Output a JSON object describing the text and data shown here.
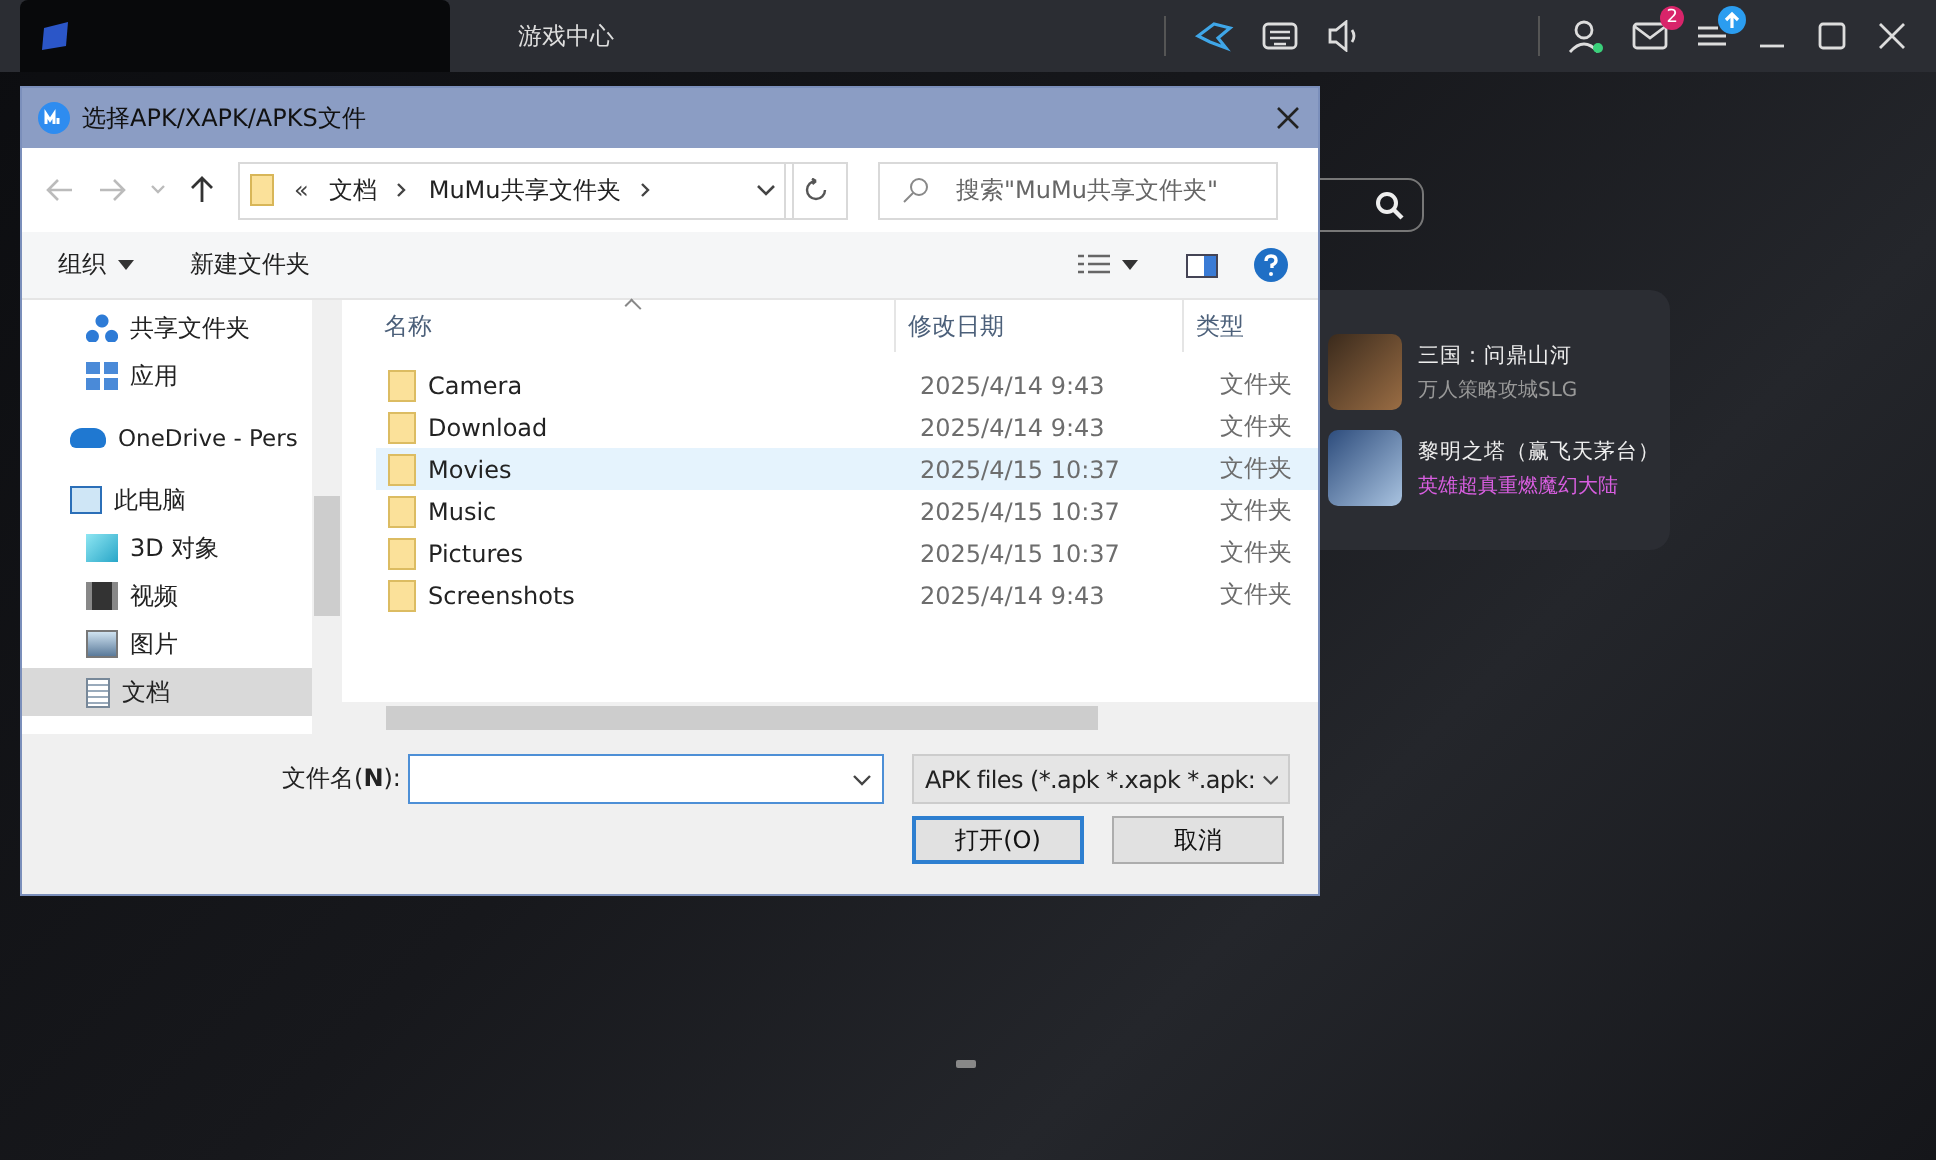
{
  "top_bar": {
    "tab": "游戏中心",
    "mail_badge": "2"
  },
  "game_list": [
    {
      "title": "三国：问鼎山河",
      "subtitle": "万人策略攻城SLG",
      "kind": "plain"
    },
    {
      "title": "黎明之塔（赢飞天茅台）",
      "subtitle": "英雄超真重燃魔幻大陆",
      "kind": "promo"
    }
  ],
  "dialog": {
    "title": "选择APK/XAPK/APKS文件",
    "address": {
      "prefix": "«",
      "segments": [
        "文档",
        "MuMu共享文件夹"
      ]
    },
    "search": {
      "placeholder": "搜索\"MuMu共享文件夹\""
    },
    "toolbar": {
      "organize": "组织",
      "new_folder": "新建文件夹"
    },
    "nav": [
      {
        "label": "共享文件夹",
        "kind": "share",
        "selected": false
      },
      {
        "label": "应用",
        "kind": "apps",
        "selected": false
      },
      {
        "label": "OneDrive - Pers",
        "kind": "cloud",
        "selected": false
      },
      {
        "label": "此电脑",
        "kind": "pc",
        "selected": false,
        "children": [
          {
            "label": "3D 对象",
            "kind": "cube",
            "selected": false
          },
          {
            "label": "视频",
            "kind": "video",
            "selected": false
          },
          {
            "label": "图片",
            "kind": "picture",
            "selected": false
          },
          {
            "label": "文档",
            "kind": "doc",
            "selected": true
          }
        ]
      }
    ],
    "columns": [
      "名称",
      "修改日期",
      "类型"
    ],
    "rows": [
      {
        "name": "Camera",
        "date": "2025/4/14 9:43",
        "type": "文件夹",
        "selected": false
      },
      {
        "name": "Download",
        "date": "2025/4/14 9:43",
        "type": "文件夹",
        "selected": false
      },
      {
        "name": "Movies",
        "date": "2025/4/15 10:37",
        "type": "文件夹",
        "selected": true
      },
      {
        "name": "Music",
        "date": "2025/4/15 10:37",
        "type": "文件夹",
        "selected": false
      },
      {
        "name": "Pictures",
        "date": "2025/4/15 10:37",
        "type": "文件夹",
        "selected": false
      },
      {
        "name": "Screenshots",
        "date": "2025/4/14 9:43",
        "type": "文件夹",
        "selected": false
      }
    ],
    "filename_label": "文件名(**N**):",
    "filter": "APK files (*.apk *.xapk *.apk:",
    "buttons": [
      "打开(O)",
      "取消"
    ]
  }
}
